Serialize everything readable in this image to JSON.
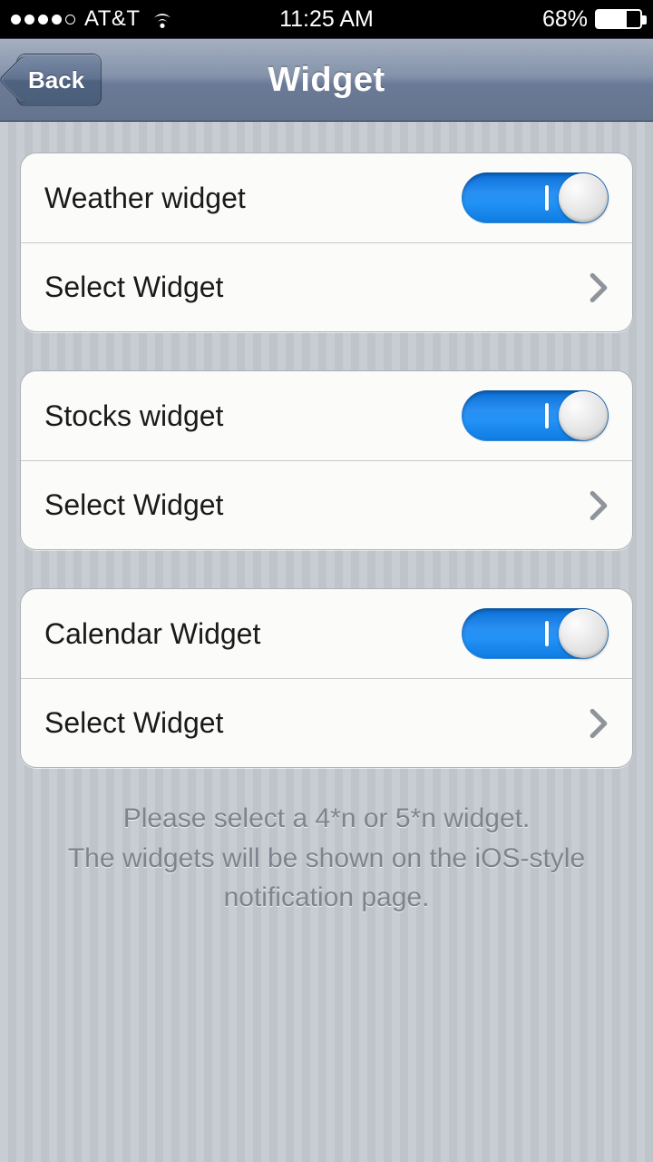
{
  "status": {
    "carrier": "AT&T",
    "time": "11:25 AM",
    "battery_pct": "68%",
    "battery_level": 68
  },
  "nav": {
    "back_label": "Back",
    "title": "Widget"
  },
  "groups": [
    {
      "title": "Weather widget",
      "select": "Select Widget",
      "on": true
    },
    {
      "title": "Stocks widget",
      "select": "Select Widget",
      "on": true
    },
    {
      "title": "Calendar Widget",
      "select": "Select Widget",
      "on": true
    }
  ],
  "note": "Please select a 4*n or 5*n widget.\nThe widgets will be shown on the iOS-style notification page."
}
